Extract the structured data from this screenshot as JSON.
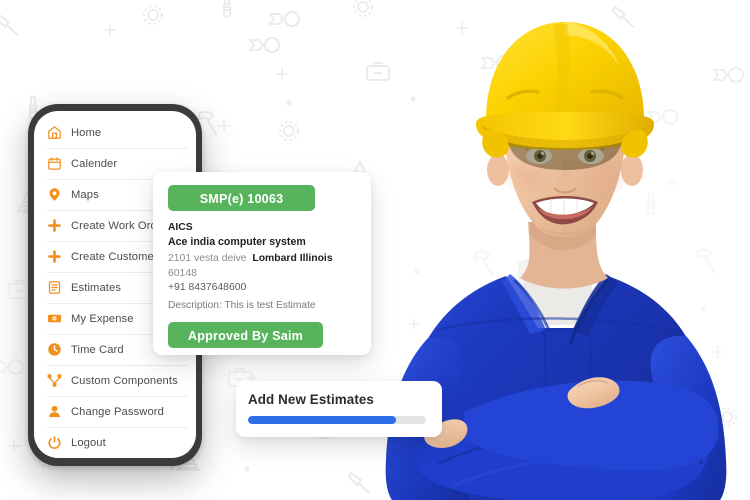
{
  "background": {
    "base_color": "#ffffff",
    "pattern_stroke": "#ebebeb",
    "pattern_icons": [
      "wrench-icon",
      "hammer-icon",
      "screwdriver-icon",
      "traffic-cone-icon",
      "paint-brush-icon",
      "toolbox-icon",
      "gear-icon",
      "plus-spark-icon",
      "dot-icon"
    ]
  },
  "phone": {
    "frame_color": "#3b3b3b",
    "screen_color": "#ffffff",
    "menu": {
      "accent_color": "#f2901f",
      "text_color": "#4c4c4c",
      "items": [
        {
          "label": "Home",
          "icon": "home-icon"
        },
        {
          "label": "Calender",
          "icon": "calendar-icon"
        },
        {
          "label": "Maps",
          "icon": "map-pin-icon"
        },
        {
          "label": "Create Work Order",
          "icon": "plus-icon"
        },
        {
          "label": "Create Customer",
          "icon": "plus-icon"
        },
        {
          "label": "Estimates",
          "icon": "document-icon"
        },
        {
          "label": "My Expense",
          "icon": "money-icon"
        },
        {
          "label": "Time Card",
          "icon": "clock-icon"
        },
        {
          "label": "Custom Components",
          "icon": "components-icon"
        },
        {
          "label": "Change Password",
          "icon": "user-icon"
        },
        {
          "label": "Logout",
          "icon": "power-icon"
        }
      ]
    }
  },
  "estimate_card": {
    "status_button": "SMP(e) 10063",
    "company_code": "AICS",
    "company_name": "Ace india computer system",
    "address_line1": "2101 vesta deive",
    "address_city": "Lombard Illinois",
    "address_zip": "60148",
    "phone": "+91 8437648600",
    "description": "Description: This is test Estimate",
    "approve_button": "Approved By Saim",
    "green_color": "#58b45c"
  },
  "add_estimates_card": {
    "title": "Add New Estimates",
    "progress_percent": 83,
    "progress_fill_color": "#2e6fe8",
    "progress_track_color": "#e3e3e5"
  },
  "worker": {
    "alt": "smiling construction worker with yellow hard hat and blue coveralls, arms crossed",
    "helmet_color": "#f7d000",
    "uniform_color": "#1b3fc4"
  }
}
